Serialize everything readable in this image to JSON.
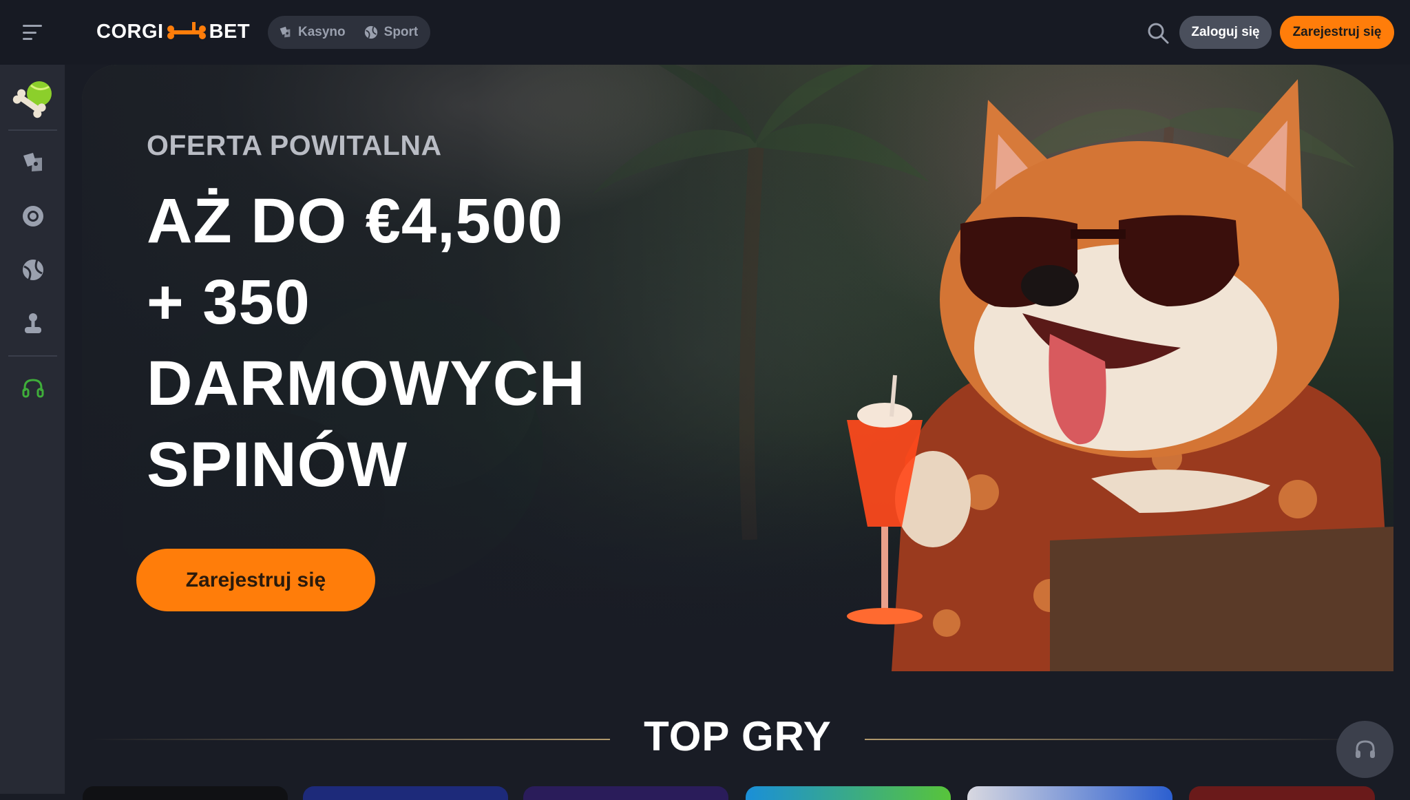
{
  "header": {
    "logo_left": "CORGI",
    "logo_right": "BET",
    "tabs": [
      {
        "label": "Kasyno",
        "icon": "casino-cards-icon"
      },
      {
        "label": "Sport",
        "icon": "ball-icon"
      }
    ],
    "login_label": "Zaloguj się",
    "register_label": "Zarejestruj się"
  },
  "sidebar": {
    "items": [
      {
        "icon": "bone-ball-logo-icon"
      },
      {
        "icon": "casino-cards-icon"
      },
      {
        "icon": "roulette-icon"
      },
      {
        "icon": "ball-icon"
      },
      {
        "icon": "joystick-icon"
      },
      {
        "icon": "headset-icon"
      }
    ]
  },
  "hero": {
    "kicker": "OFERTA POWITALNA",
    "title_lines": [
      "AŻ DO €4,500",
      "+ 350",
      "DARMOWYCH",
      "SPINÓW"
    ],
    "cta_label": "Zarejestruj się"
  },
  "section": {
    "title": "TOP GRY"
  },
  "colors": {
    "accent": "#ff7d0a",
    "background": "#191c25",
    "sidebar": "#272a34",
    "support_icon": "#3fae3a"
  }
}
